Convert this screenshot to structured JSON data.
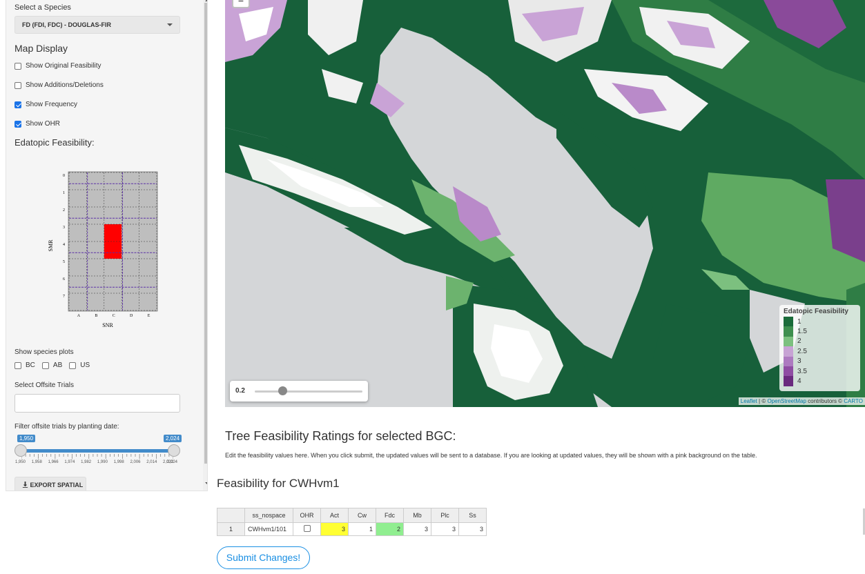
{
  "sidebar": {
    "species_label": "Select a Species",
    "species_value": "FD (FDI, FDC) - DOUGLAS-FIR",
    "map_display_heading": "Map Display",
    "checkboxes": [
      {
        "label": "Show Original Feasibility",
        "checked": false
      },
      {
        "label": "Show Additions/Deletions",
        "checked": false
      },
      {
        "label": "Show Frequency",
        "checked": true
      },
      {
        "label": "Show OHR",
        "checked": true
      }
    ],
    "edatopic_heading": "Edatopic Feasibility:",
    "species_plots_label": "Show species plots",
    "species_plots": [
      {
        "label": "BC",
        "checked": false
      },
      {
        "label": "AB",
        "checked": false
      },
      {
        "label": "US",
        "checked": false
      }
    ],
    "offsite_label": "Select Offsite Trials",
    "offsite_value": "",
    "date_filter_label": "Filter offsite trials by planting date:",
    "date_range": {
      "min": 1950,
      "max": 2024,
      "from": 1950,
      "to": 2024,
      "from_label": "1,950",
      "to_label": "2,024",
      "tick_labels": [
        "1,950",
        "1,958",
        "1,966",
        "1,974",
        "1,982",
        "1,990",
        "1,998",
        "2,006",
        "2,014",
        "2,022",
        "2,024"
      ]
    },
    "export_label": "EXPORT SPATIAL"
  },
  "edatopic_grid": {
    "ylabel": "SMR",
    "xlabel": "SNR",
    "y_ticks": [
      "0",
      "1",
      "2",
      "3",
      "4",
      "5",
      "6",
      "7"
    ],
    "x_ticks": [
      "A",
      "B",
      "C",
      "D",
      "E"
    ],
    "highlight": {
      "column": "C",
      "rows": [
        "3",
        "4"
      ],
      "color": "#ff0000"
    },
    "cell_color": "#bebebe"
  },
  "map": {
    "zoom_out": "−",
    "opacity_value": "0.2",
    "opacity_fraction": 0.2,
    "legend": {
      "title": "Edatopic Feasibility",
      "items": [
        {
          "label": "1",
          "color": "#1b6b3a"
        },
        {
          "label": "1.5",
          "color": "#3f8f4f"
        },
        {
          "label": "2",
          "color": "#7cc07f"
        },
        {
          "label": "2.5",
          "color": "#c7a3d4"
        },
        {
          "label": "3",
          "color": "#ad7ac0"
        },
        {
          "label": "3.5",
          "color": "#8f4da3"
        },
        {
          "label": "4",
          "color": "#6a2a7e"
        }
      ]
    },
    "attribution": {
      "leaflet": "Leaflet",
      "sep1": " | © ",
      "osm": "OpenStreetMap",
      "contributors": " contributors © ",
      "carto": "CARTO"
    }
  },
  "main": {
    "section_title": "Tree Feasibility Ratings for selected BGC:",
    "section_desc": "Edit the feasibility values here. When you click submit, the updated values will be sent to a database. If you are looking at updated values, they will be shown with a pink background on the table.",
    "feas_title": "Feasibility for CWHvm1",
    "table": {
      "headers": [
        "",
        "ss_nospace",
        "OHR",
        "Act",
        "Cw",
        "Fdc",
        "Mb",
        "Plc",
        "Ss"
      ],
      "rows": [
        {
          "n": "1",
          "ss_nospace": "CWHvm1/101",
          "ohr": false,
          "act": "3",
          "cw": "1",
          "fdc": "2",
          "mb": "3",
          "plc": "3",
          "ss": "3"
        }
      ],
      "highlight_colors": {
        "act": "#ffff33",
        "fdc": "#90ee90"
      }
    },
    "submit_label": "Submit Changes!"
  }
}
